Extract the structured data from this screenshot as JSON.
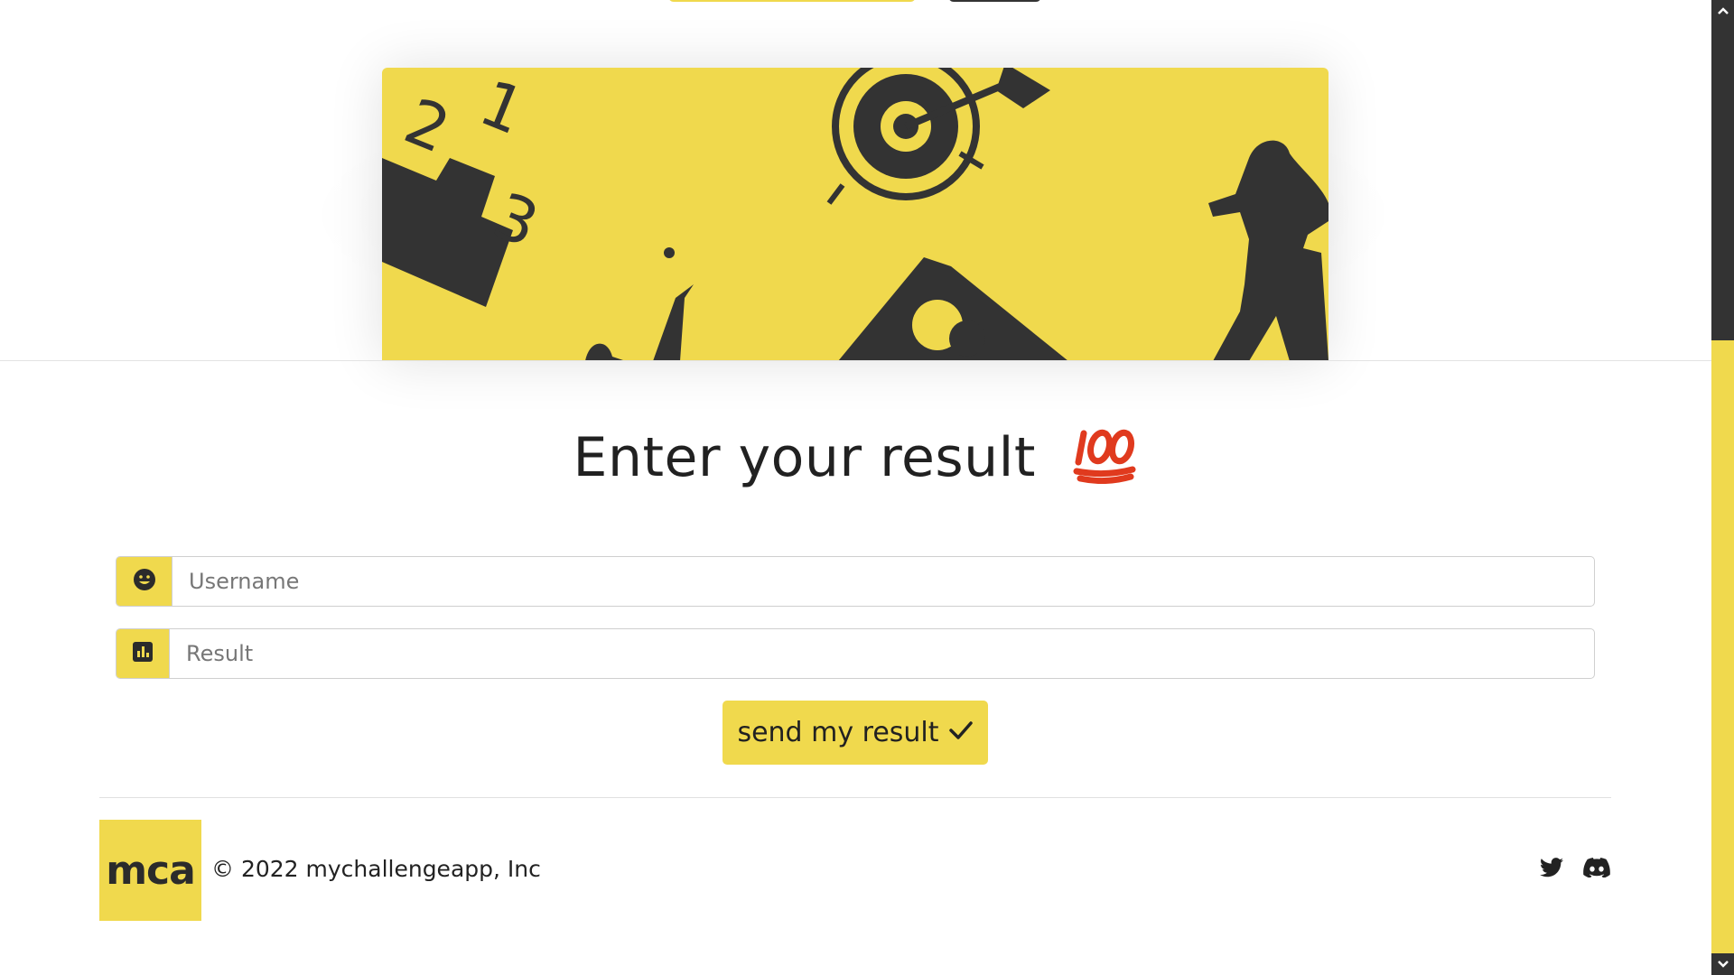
{
  "page": {
    "heading": "Enter your result",
    "heading_emoji": "💯"
  },
  "form": {
    "username_placeholder": "Username",
    "result_placeholder": "Result",
    "submit_label": "send my result"
  },
  "footer": {
    "logo_text": "mca",
    "copyright": "© 2022 mychallengeapp, Inc",
    "social": [
      "twitter-icon",
      "discord-icon"
    ]
  },
  "icons": {
    "username": "smile-icon",
    "result": "bar-chart-icon",
    "submit": "check-icon"
  },
  "colors": {
    "brand_yellow": "#f0d94d",
    "dark": "#333333"
  }
}
